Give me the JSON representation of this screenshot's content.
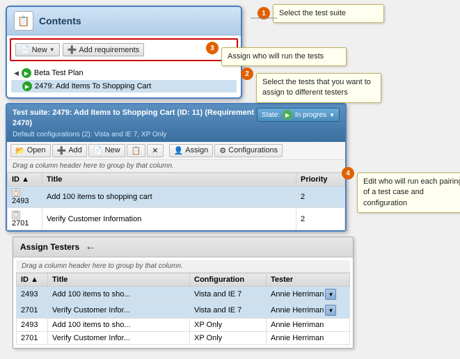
{
  "contents": {
    "title": "Contents",
    "toolbar": {
      "new_label": "New",
      "add_req_label": "Add requirements"
    },
    "tree": {
      "beta_label": "Beta Test Plan",
      "test_item": "2479: Add Items To Shopping Cart"
    }
  },
  "testsuite": {
    "header_line1": "Test suite: 2479: Add Items to Shopping Cart (ID: 11) (Requirement 2470)",
    "header_line2": "Default configurations (2): Vista and IE 7, XP Only",
    "state_label": "State:",
    "state_value": "In progres",
    "toolbar": {
      "open": "Open",
      "add": "Add",
      "new": "New",
      "delete": "X",
      "assign": "Assign",
      "configurations": "Configurations"
    },
    "drag_hint": "Drag a column header here to group by that column.",
    "columns": [
      "ID",
      "Title",
      "Priority"
    ],
    "rows": [
      {
        "id": "2493",
        "title": "Add 100 items to shopping cart",
        "priority": "2"
      },
      {
        "id": "2701",
        "title": "Verify Customer Information",
        "priority": "2"
      }
    ]
  },
  "assign_testers": {
    "title": "Assign Testers",
    "drag_hint": "Drag a column header here to group by that column.",
    "columns": [
      "ID",
      "Title",
      "Configuration",
      "Tester"
    ],
    "rows": [
      {
        "id": "2493",
        "title": "Add 100 items to sho...",
        "config": "Vista and IE 7",
        "tester": "Annie Herriman",
        "highlighted": true
      },
      {
        "id": "2701",
        "title": "Verify Customer Infor...",
        "config": "Vista and IE 7",
        "tester": "Annie Herriman",
        "highlighted": true
      },
      {
        "id": "2493",
        "title": "Add 100 items to sho...",
        "config": "XP Only",
        "tester": "Annie Herriman",
        "highlighted": false
      },
      {
        "id": "2701",
        "title": "Verify Customer Infor...",
        "config": "XP Only",
        "tester": "Annie Herriman",
        "highlighted": false
      }
    ]
  },
  "callouts": {
    "c1": "Select the test suite",
    "c2": "Select the tests that you want to assign to different testers",
    "c3": "Assign who will run the tests",
    "c4": "Edit who will run each pairing of a test case and configuration"
  },
  "icons": {
    "folder": "📁",
    "new": "📄",
    "add": "➕",
    "open": "📂",
    "assign": "👤",
    "config": "⚙",
    "play": "▶",
    "arrow_left": "←",
    "sort_asc": "▲"
  }
}
